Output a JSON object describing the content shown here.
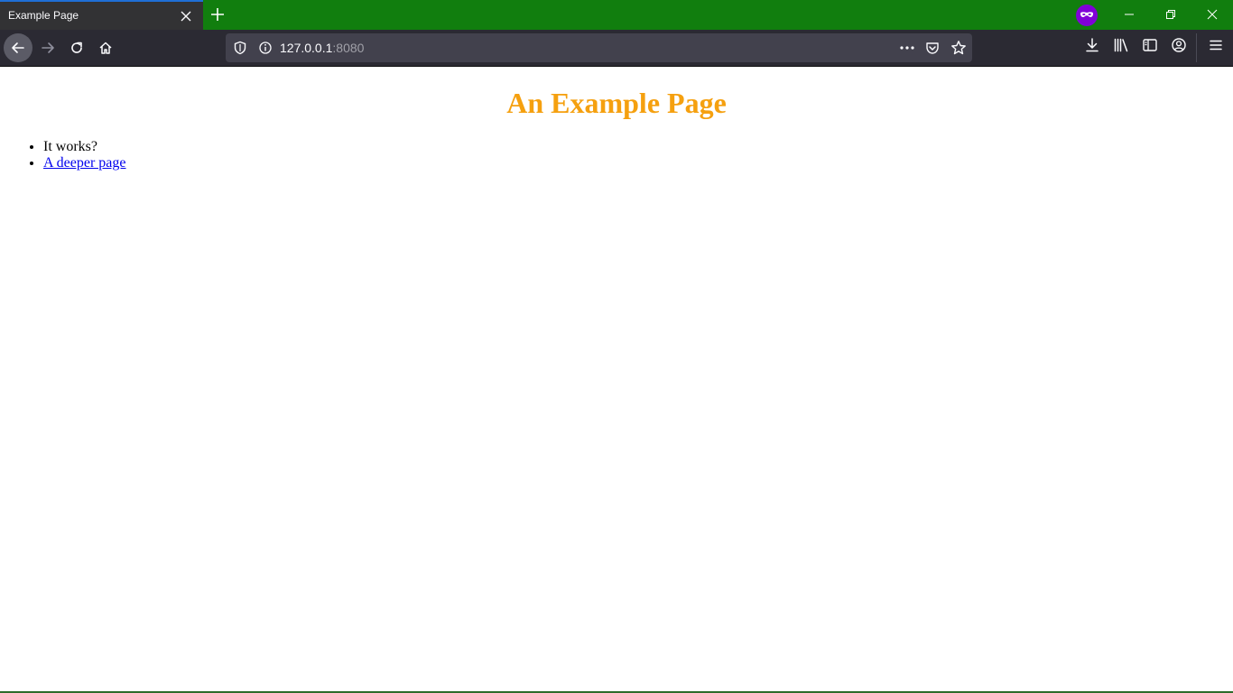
{
  "browser": {
    "tab": {
      "title": "Example Page"
    },
    "address": {
      "host": "127.0.0.1",
      "port": ":8080"
    },
    "colors": {
      "tab_strip": "#117e0e",
      "active_tab": "#323234",
      "tab_accent": "#1f6fd6",
      "toolbar": "#2b2a33",
      "urlbar": "#42414d",
      "private_badge": "#8000d7"
    }
  },
  "page": {
    "heading": "An Example Page",
    "heading_color": "#f5a00f",
    "list": [
      {
        "text": "It works?"
      },
      {
        "text": "A deeper page",
        "is_link": true
      }
    ]
  }
}
